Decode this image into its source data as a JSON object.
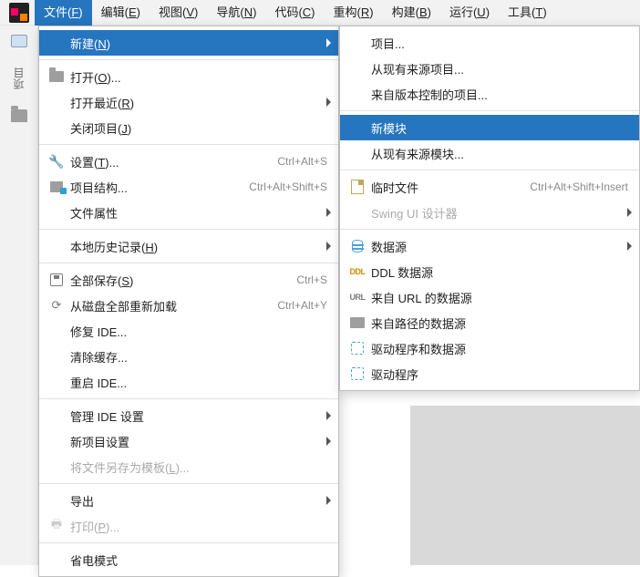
{
  "menubar": {
    "items": [
      {
        "pre": "文件(",
        "key": "F",
        "post": ")"
      },
      {
        "pre": "编辑(",
        "key": "E",
        "post": ")"
      },
      {
        "pre": "视图(",
        "key": "V",
        "post": ")"
      },
      {
        "pre": "导航(",
        "key": "N",
        "post": ")"
      },
      {
        "pre": "代码(",
        "key": "C",
        "post": ")"
      },
      {
        "pre": "重构(",
        "key": "R",
        "post": ")"
      },
      {
        "pre": "构建(",
        "key": "B",
        "post": ")"
      },
      {
        "pre": "运行(",
        "key": "U",
        "post": ")"
      },
      {
        "pre": "工具(",
        "key": "T",
        "post": ")"
      }
    ]
  },
  "gutter": {
    "project_label": "项目"
  },
  "file_menu": [
    {
      "type": "item",
      "icon": "",
      "pre": "新建(",
      "key": "N",
      "post": ")",
      "shortcut": "",
      "submenu": true,
      "highlight": true
    },
    {
      "type": "sep"
    },
    {
      "type": "item",
      "icon": "folder",
      "pre": "打开(",
      "key": "O",
      "post": ")...",
      "shortcut": ""
    },
    {
      "type": "item",
      "icon": "",
      "pre": "打开最近(",
      "key": "R",
      "post": ")",
      "shortcut": "",
      "submenu": true
    },
    {
      "type": "item",
      "icon": "",
      "pre": "关闭项目(",
      "key": "J",
      "post": ")",
      "shortcut": ""
    },
    {
      "type": "sep"
    },
    {
      "type": "item",
      "icon": "wrench",
      "pre": "设置(",
      "key": "T",
      "post": ")...",
      "shortcut": "Ctrl+Alt+S"
    },
    {
      "type": "item",
      "icon": "struct",
      "pre": "项目结构...",
      "key": "",
      "post": "",
      "shortcut": "Ctrl+Alt+Shift+S"
    },
    {
      "type": "item",
      "icon": "",
      "pre": "文件属性",
      "key": "",
      "post": "",
      "shortcut": "",
      "submenu": true
    },
    {
      "type": "sep"
    },
    {
      "type": "item",
      "icon": "",
      "pre": "本地历史记录(",
      "key": "H",
      "post": ")",
      "shortcut": "",
      "submenu": true
    },
    {
      "type": "sep"
    },
    {
      "type": "item",
      "icon": "save",
      "pre": "全部保存(",
      "key": "S",
      "post": ")",
      "shortcut": "Ctrl+S"
    },
    {
      "type": "item",
      "icon": "reload",
      "pre": "从磁盘全部重新加载",
      "key": "",
      "post": "",
      "shortcut": "Ctrl+Alt+Y"
    },
    {
      "type": "item",
      "icon": "",
      "pre": "修复 IDE...",
      "key": "",
      "post": "",
      "shortcut": ""
    },
    {
      "type": "item",
      "icon": "",
      "pre": "清除缓存...",
      "key": "",
      "post": "",
      "shortcut": ""
    },
    {
      "type": "item",
      "icon": "",
      "pre": "重启 IDE...",
      "key": "",
      "post": "",
      "shortcut": ""
    },
    {
      "type": "sep"
    },
    {
      "type": "item",
      "icon": "",
      "pre": "管理 IDE 设置",
      "key": "",
      "post": "",
      "shortcut": "",
      "submenu": true
    },
    {
      "type": "item",
      "icon": "",
      "pre": "新项目设置",
      "key": "",
      "post": "",
      "shortcut": "",
      "submenu": true
    },
    {
      "type": "item",
      "icon": "",
      "pre": "将文件另存为模板(",
      "key": "L",
      "post": ")...",
      "shortcut": "",
      "disabled": true
    },
    {
      "type": "sep"
    },
    {
      "type": "item",
      "icon": "",
      "pre": "导出",
      "key": "",
      "post": "",
      "shortcut": "",
      "submenu": true
    },
    {
      "type": "item",
      "icon": "print",
      "pre": "打印(",
      "key": "P",
      "post": ")...",
      "shortcut": "",
      "disabled": true
    },
    {
      "type": "sep"
    },
    {
      "type": "item",
      "icon": "",
      "pre": "省电模式",
      "key": "",
      "post": "",
      "shortcut": ""
    }
  ],
  "new_menu": [
    {
      "type": "item",
      "icon": "",
      "label": "项目...",
      "shortcut": ""
    },
    {
      "type": "item",
      "icon": "",
      "label": "从现有来源项目...",
      "shortcut": ""
    },
    {
      "type": "item",
      "icon": "",
      "label": "来自版本控制的项目...",
      "shortcut": ""
    },
    {
      "type": "sep"
    },
    {
      "type": "item",
      "icon": "",
      "label": "新模块",
      "shortcut": "",
      "highlight": true
    },
    {
      "type": "item",
      "icon": "",
      "label": "从现有来源模块...",
      "shortcut": ""
    },
    {
      "type": "sep"
    },
    {
      "type": "item",
      "icon": "scratch",
      "label": "临时文件",
      "shortcut": "Ctrl+Alt+Shift+Insert"
    },
    {
      "type": "item",
      "icon": "",
      "label": "Swing UI 设计器",
      "shortcut": "",
      "submenu": true,
      "disabled": true
    },
    {
      "type": "sep"
    },
    {
      "type": "item",
      "icon": "db",
      "label": "数据源",
      "shortcut": "",
      "submenu": true
    },
    {
      "type": "item",
      "icon": "ddl",
      "label": "DDL 数据源",
      "shortcut": ""
    },
    {
      "type": "item",
      "icon": "url",
      "label": "来自 URL 的数据源",
      "shortcut": ""
    },
    {
      "type": "item",
      "icon": "path",
      "label": "来自路径的数据源",
      "shortcut": ""
    },
    {
      "type": "item",
      "icon": "driver",
      "label": "驱动程序和数据源",
      "shortcut": ""
    },
    {
      "type": "item",
      "icon": "driver",
      "label": "驱动程序",
      "shortcut": ""
    }
  ]
}
